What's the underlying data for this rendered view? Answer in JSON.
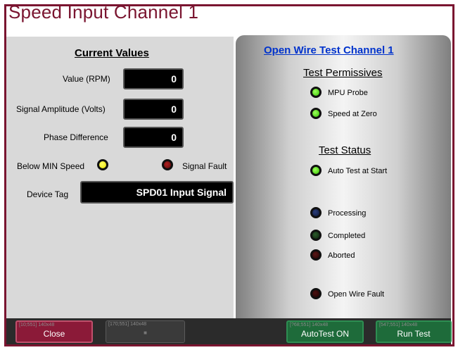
{
  "window": {
    "title": "Speed Input Channel 1"
  },
  "current_values": {
    "header": "Current Values",
    "value_rpm": {
      "label": "Value (RPM)",
      "value": "0"
    },
    "signal_amplitude": {
      "label": "Signal Amplitude (Volts)",
      "value": "0"
    },
    "phase_difference": {
      "label": "Phase Difference",
      "value": "0"
    },
    "below_min_speed": {
      "label": "Below MIN Speed",
      "state": "on",
      "color": "#e8e000"
    },
    "signal_fault": {
      "label": "Signal Fault",
      "state": "off",
      "color": "#7a0f0f"
    },
    "device_tag": {
      "label": "Device Tag",
      "value": "SPD01 Input Signal"
    }
  },
  "open_wire": {
    "title": "Open Wire Test Channel 1",
    "permissives_header": "Test Permissives",
    "permissives": [
      {
        "label": "MPU Probe",
        "state": "on",
        "color": "#34c400"
      },
      {
        "label": "Speed at Zero",
        "state": "on",
        "color": "#34c400"
      }
    ],
    "status_header": "Test Status",
    "status": [
      {
        "label": "Auto Test at Start",
        "state": "on",
        "color": "#34c400"
      },
      {
        "label": "Processing",
        "state": "off",
        "color": "#1a2a5a"
      },
      {
        "label": "Completed",
        "state": "off",
        "color": "#1b3b1b"
      },
      {
        "label": "Aborted",
        "state": "off",
        "color": "#3a0a0a"
      },
      {
        "label": "Open Wire Fault",
        "state": "off",
        "color": "#2a0505"
      }
    ]
  },
  "footer": {
    "close": {
      "label": "Close",
      "debug": "[10;551] 140x48"
    },
    "placeholder": {
      "label": "■",
      "debug": "[170;551] 140x48"
    },
    "auto_test": {
      "label": "AutoTest ON",
      "debug": "[?68;551] 140x48"
    },
    "run_test": {
      "label": "Run Test",
      "debug": "[547;551] 140x48"
    }
  },
  "colors": {
    "brand": "#7a1530",
    "link": "#0033cc",
    "close_button": "#8b1a38",
    "action_button": "#1e6b3a"
  }
}
